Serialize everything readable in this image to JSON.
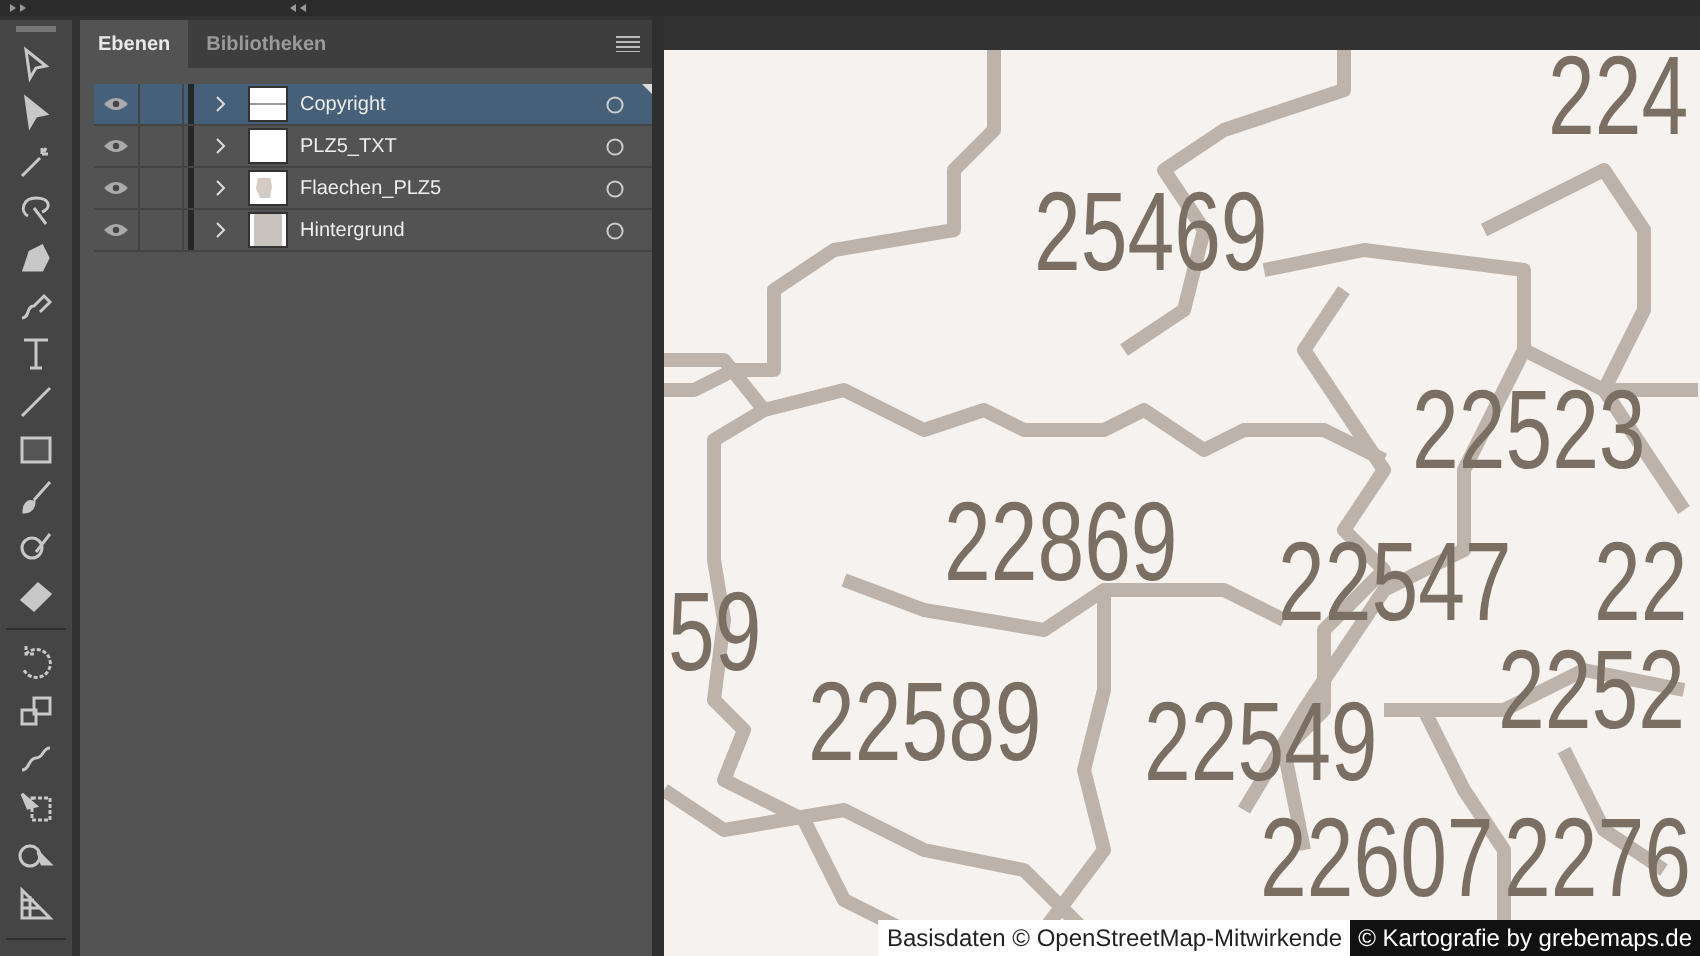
{
  "panel": {
    "tabs": [
      {
        "label": "Ebenen",
        "selected": true
      },
      {
        "label": "Bibliotheken",
        "selected": false
      }
    ]
  },
  "layers": [
    {
      "name": "Copyright",
      "selected": true,
      "visible": true,
      "kind": "line"
    },
    {
      "name": "PLZ5_TXT",
      "selected": false,
      "visible": true,
      "kind": "blank"
    },
    {
      "name": "Flaechen_PLZ5",
      "selected": false,
      "visible": true,
      "kind": "shape"
    },
    {
      "name": "Hintergrund",
      "selected": false,
      "visible": true,
      "kind": "fill"
    }
  ],
  "map": {
    "labels": [
      "224",
      "25469",
      "22523",
      "22869",
      "22547",
      "22",
      "59",
      "22589",
      "22549",
      "2252",
      "22607",
      "2276"
    ],
    "attribution": {
      "data": "Basisdaten © OpenStreetMap-Mitwirkende",
      "credit": "© Kartografie by grebemaps.de"
    }
  }
}
